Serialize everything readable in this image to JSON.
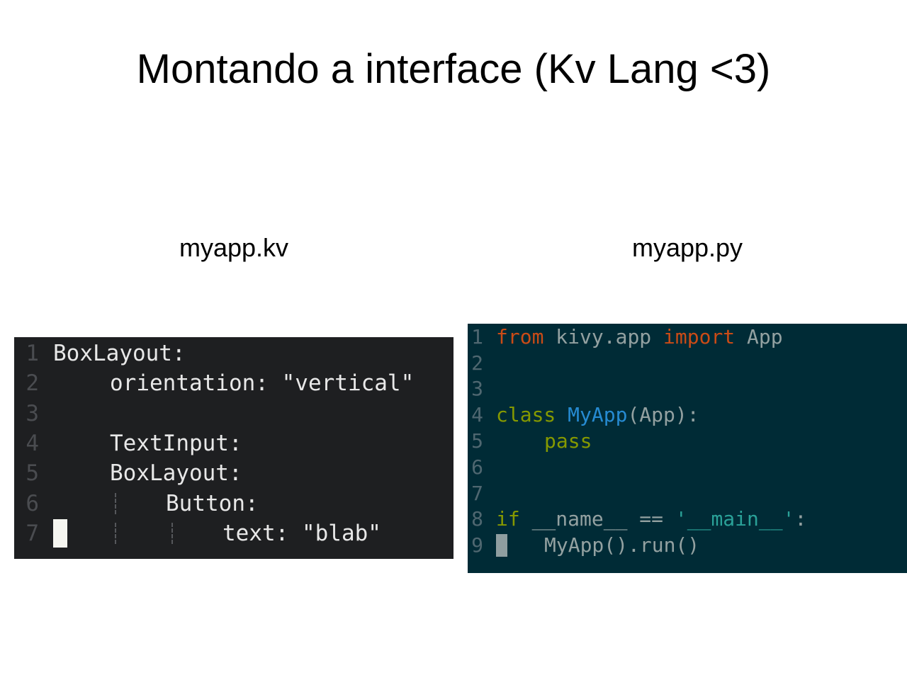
{
  "slide": {
    "title": "Montando a interface (Kv Lang <3)",
    "left_label": "myapp.kv",
    "right_label": "myapp.py"
  },
  "kv_editor": {
    "background": "#1e1f21",
    "lines": [
      {
        "number": "1",
        "text": "BoxLayout:"
      },
      {
        "number": "2",
        "text": "orientation: \"vertical\""
      },
      {
        "number": "3",
        "text": ""
      },
      {
        "number": "4",
        "text": "TextInput:"
      },
      {
        "number": "5",
        "text": "BoxLayout:"
      },
      {
        "number": "6",
        "text": "Button:"
      },
      {
        "number": "7",
        "text": "text: \"blab\""
      }
    ]
  },
  "py_editor": {
    "background": "#002b36",
    "line_numbers": [
      "1",
      "2",
      "3",
      "4",
      "5",
      "6",
      "7",
      "8",
      "9"
    ],
    "line1": {
      "kw_from": "from",
      "module": "kivy.app",
      "kw_import": "import",
      "name": "App"
    },
    "line4": {
      "kw_class": "class",
      "class_name": "MyApp",
      "args": "(App):"
    },
    "line5": {
      "kw_pass": "pass"
    },
    "line8": {
      "kw_if": "if",
      "dunder": "__name__",
      "op": "==",
      "q1": "'",
      "main": "__main__",
      "q2": "'",
      "colon": ":"
    },
    "line9": {
      "call": "MyApp().run()"
    }
  },
  "colors": {
    "keyword_orange": "#cb4b16",
    "keyword_green": "#859900",
    "class_blue": "#268bd2",
    "string_cyan": "#2aa198"
  }
}
